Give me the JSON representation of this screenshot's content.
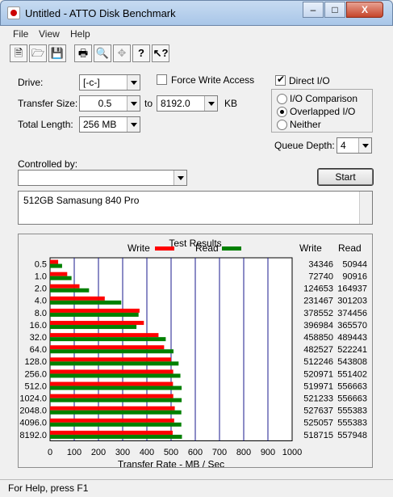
{
  "window": {
    "title": "Untitled - ATTO Disk Benchmark",
    "minimize": "–",
    "maximize": "□",
    "close": "X"
  },
  "menu": {
    "file": "File",
    "view": "View",
    "help": "Help"
  },
  "toolbar": {
    "new": "new-doc",
    "open": "open-folder",
    "save": "save-disk",
    "print": "printer",
    "preview": "print-preview",
    "move": "move",
    "help": "help",
    "context_help": "context-help"
  },
  "settings": {
    "drive_label": "Drive:",
    "drive_value": "[-c-]",
    "force_write_label": "Force Write Access",
    "force_write_checked": false,
    "direct_io_label": "Direct I/O",
    "direct_io_checked": true,
    "transfer_size_label": "Transfer Size:",
    "transfer_from": "0.5",
    "to_label": "to",
    "transfer_to": "8192.0",
    "kb_label": "KB",
    "total_length_label": "Total Length:",
    "total_length_value": "256 MB",
    "io_comparison_label": "I/O Comparison",
    "overlapped_io_label": "Overlapped I/O",
    "neither_label": "Neither",
    "selected_mode": "overlapped",
    "queue_depth_label": "Queue Depth:",
    "queue_depth_value": "4",
    "controlled_by_label": "Controlled by:",
    "controlled_by_value": "",
    "start_label": "Start",
    "description": "512GB Samasung 840 Pro"
  },
  "chart_data": {
    "type": "bar",
    "title": "Test Results",
    "xlabel": "Transfer Rate - MB / Sec",
    "xlim": [
      0,
      1000
    ],
    "xticks": [
      "0",
      "100",
      "200",
      "300",
      "400",
      "500",
      "600",
      "700",
      "800",
      "900",
      "1000"
    ],
    "categories": [
      "0.5",
      "1.0",
      "2.0",
      "4.0",
      "8.0",
      "16.0",
      "32.0",
      "64.0",
      "128.0",
      "256.0",
      "512.0",
      "1024.0",
      "2048.0",
      "4096.0",
      "8192.0"
    ],
    "series": [
      {
        "name": "Write",
        "color": "#ff0000",
        "values_kb": [
          34346,
          72740,
          124653,
          231467,
          378552,
          396984,
          458850,
          482527,
          512246,
          520971,
          519971,
          521233,
          527637,
          525057,
          518715
        ]
      },
      {
        "name": "Read",
        "color": "#008000",
        "values_kb": [
          50944,
          90916,
          164937,
          301203,
          374456,
          365570,
          489443,
          522241,
          543808,
          551402,
          556663,
          556663,
          555383,
          555383,
          557948
        ]
      }
    ],
    "column_headers": {
      "write": "Write",
      "read": "Read"
    },
    "legend": "top"
  },
  "status": {
    "text": "For Help, press F1"
  }
}
